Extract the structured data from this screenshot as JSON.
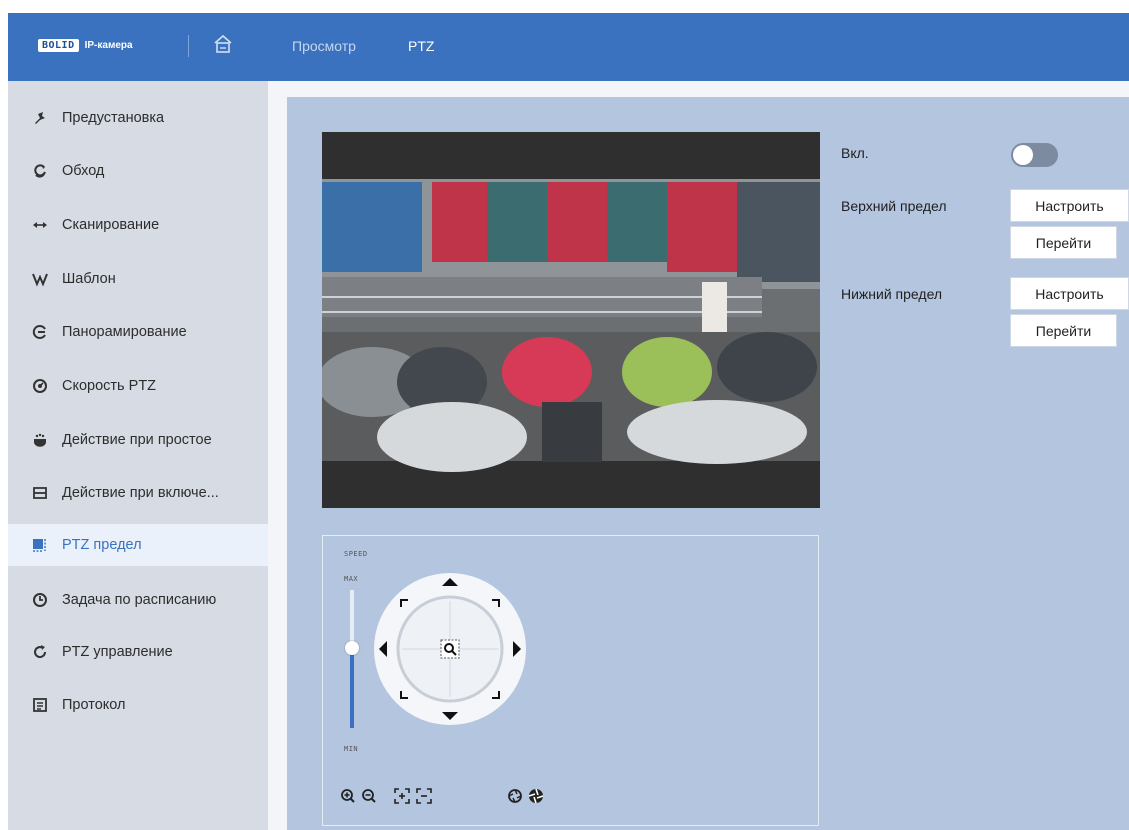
{
  "header": {
    "logo_brand": "BOLID",
    "logo_subtitle": "IP-камера",
    "nav": [
      "Просмотр",
      "PTZ"
    ],
    "active_nav": "PTZ",
    "colors": {
      "bar": "#3a72bf",
      "accent": "#3a72bf"
    }
  },
  "sidebar": {
    "items": [
      {
        "label": "Предустановка",
        "icon": "pin-icon"
      },
      {
        "label": "Обход",
        "icon": "tour-icon"
      },
      {
        "label": "Сканирование",
        "icon": "scan-arrows-icon"
      },
      {
        "label": "Шаблон",
        "icon": "pattern-icon"
      },
      {
        "label": "Панорамирование",
        "icon": "pan-icon"
      },
      {
        "label": "Скорость PTZ",
        "icon": "speed-icon"
      },
      {
        "label": "Действие при простое",
        "icon": "idle-icon"
      },
      {
        "label": "Действие при включе...",
        "icon": "power-up-icon"
      },
      {
        "label": "PTZ предел",
        "icon": "limit-icon"
      },
      {
        "label": "Задача по расписанию",
        "icon": "clock-icon"
      },
      {
        "label": "PTZ управление",
        "icon": "refresh-icon"
      },
      {
        "label": "Протокол",
        "icon": "protocol-icon"
      }
    ],
    "active_index": 8
  },
  "limits": {
    "enable_label": "Вкл.",
    "enabled": false,
    "upper_label": "Верхний предел",
    "lower_label": "Нижний предел",
    "set_label": "Настроить",
    "go_label": "Перейти"
  },
  "ptz": {
    "speed_label": "SPEED",
    "max_label": "MAX",
    "min_label": "MIN",
    "speed_level": 0.55
  }
}
